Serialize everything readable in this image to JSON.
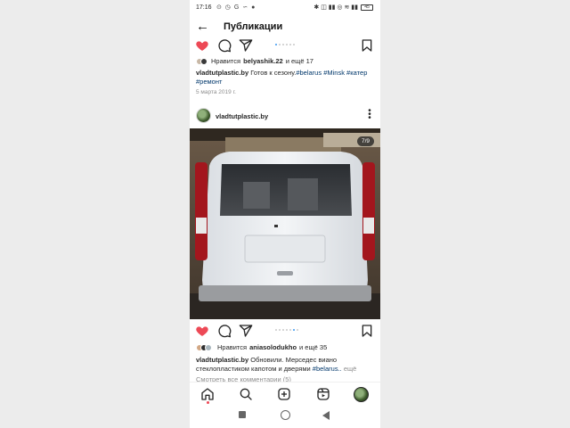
{
  "status_bar": {
    "time": "17:16",
    "left_icons": "⊙ ◷ G ∽ ●",
    "right_icons": "✱ ◫ ▮▮ ◎ ≋ ▮▮",
    "battery": "45"
  },
  "header": {
    "title": "Публикации"
  },
  "post1": {
    "likes_text": "Нравится",
    "likes_user": "belyashik.22",
    "likes_rest": "и ещё 17",
    "caption_user": "vladtutplastic.by",
    "caption_text": "Готов к сезону.",
    "tag1": "#belarus",
    "tag2": "#Minsk",
    "tag3": "#катер",
    "tag4": "#ремонт",
    "date": "5 марта 2019 г."
  },
  "post2": {
    "username": "vladtutplastic.by",
    "counter": "7/9",
    "likes_text": "Нравится",
    "likes_user": "aniasolodukho",
    "likes_rest": "и ещё 35",
    "caption_user": "vladtutplastic.by",
    "caption_text": "Обновили. Мерседес виано стеклопластиком капотом и дверями",
    "caption_tag": "#belarus..",
    "more": "ещё",
    "view_all": "Смотреть все комментарии (5)"
  },
  "colors": {
    "like_red": "#ed4956",
    "hashtag_blue": "#00376b",
    "active_dot": "#3897f0"
  },
  "icons": {
    "back": "arrow-left-icon",
    "like": "heart-filled-icon",
    "comment": "comment-icon",
    "share": "send-icon",
    "save": "bookmark-icon",
    "home": "home-icon",
    "search": "search-icon",
    "new_post": "plus-square-icon",
    "reels": "reels-icon",
    "profile": "profile-avatar-icon"
  }
}
